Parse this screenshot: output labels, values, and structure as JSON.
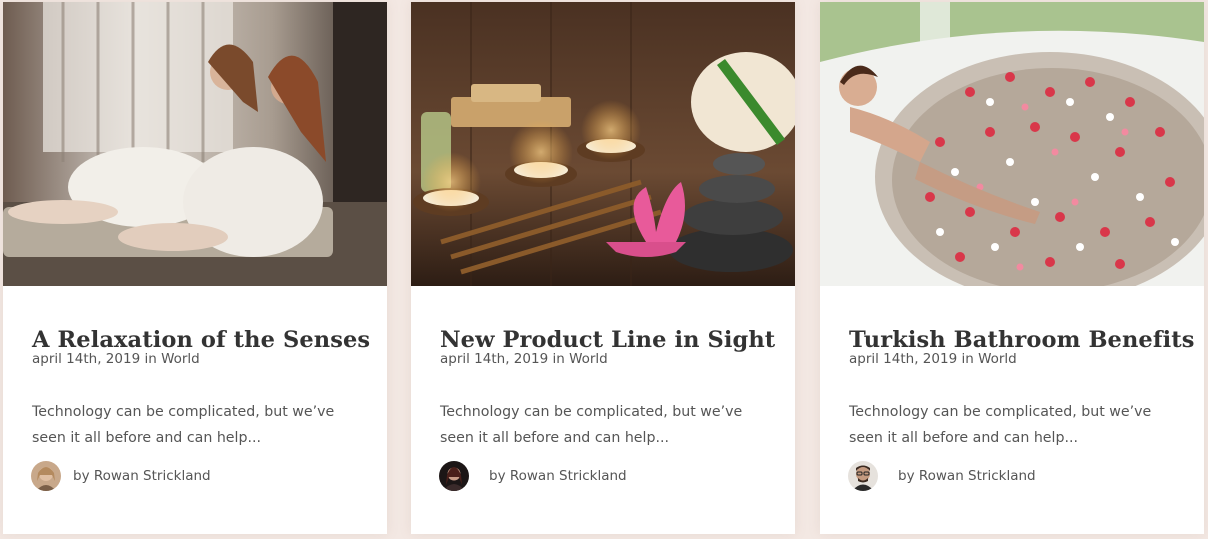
{
  "posts": [
    {
      "title": "A Relaxation of the Senses",
      "date": "april 14th, 2019",
      "in_label": "in",
      "category": "World",
      "excerpt": "Technology can be complicated, but we’ve seen it all before and can help...",
      "author": "by Rowan Strickland"
    },
    {
      "title": "New Product Line in Sight",
      "date": "april 14th, 2019",
      "in_label": "in",
      "category": "World",
      "excerpt": "Technology can be complicated, but we’ve seen it all before and can help...",
      "author": "by Rowan Strickland"
    },
    {
      "title": "Turkish Bathroom Benefits",
      "date": "april 14th, 2019",
      "in_label": "in",
      "category": "World",
      "excerpt": "Technology can be complicated, but we’ve seen it all before and can help...",
      "author": "by Rowan Strickland"
    }
  ],
  "colors": {
    "page_background": "#f3e8e3",
    "card_background": "#ffffff",
    "title_text": "#333333",
    "body_text": "#555555"
  },
  "icons": {
    "image_1": "women-in-bathrobes-photo",
    "image_2": "candles-and-spa-stones-photo",
    "image_3": "flower-petal-bath-photo",
    "avatar": "author-avatar-photo"
  }
}
